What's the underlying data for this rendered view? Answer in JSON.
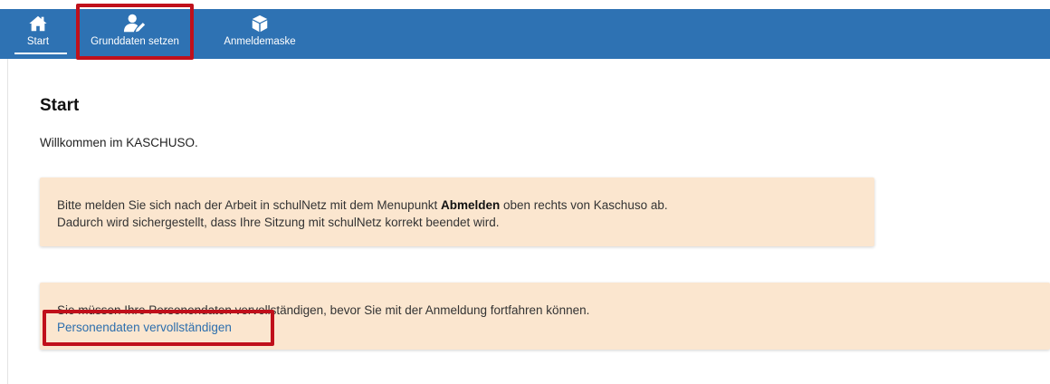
{
  "nav": {
    "items": [
      {
        "label": "Start",
        "icon": "home-icon",
        "active": true
      },
      {
        "label": "Grunddaten setzen",
        "icon": "user-edit-icon",
        "active": false
      },
      {
        "label": "Anmeldemaske",
        "icon": "cube-icon",
        "active": false
      }
    ],
    "bar_color": "#2e72b3"
  },
  "main": {
    "title": "Start",
    "welcome": "Willkommen im KASCHUSO.",
    "notice1": {
      "line1_before": "Bitte melden Sie sich nach der Arbeit in schulNetz mit dem Menupunkt ",
      "line1_bold": "Abmelden",
      "line1_after": " oben rechts von Kaschuso ab.",
      "line2": "Dadurch wird sichergestellt, dass Ihre Sitzung mit schulNetz korrekt beendet wird."
    },
    "notice2": {
      "text": "Sie müssen Ihre Personendaten vervollständigen, bevor Sie mit der Anmeldung fortfahren können.",
      "link": "Personendaten vervollständigen"
    },
    "alert_color": "#fbe6cf",
    "highlight_color": "#c0101b"
  }
}
